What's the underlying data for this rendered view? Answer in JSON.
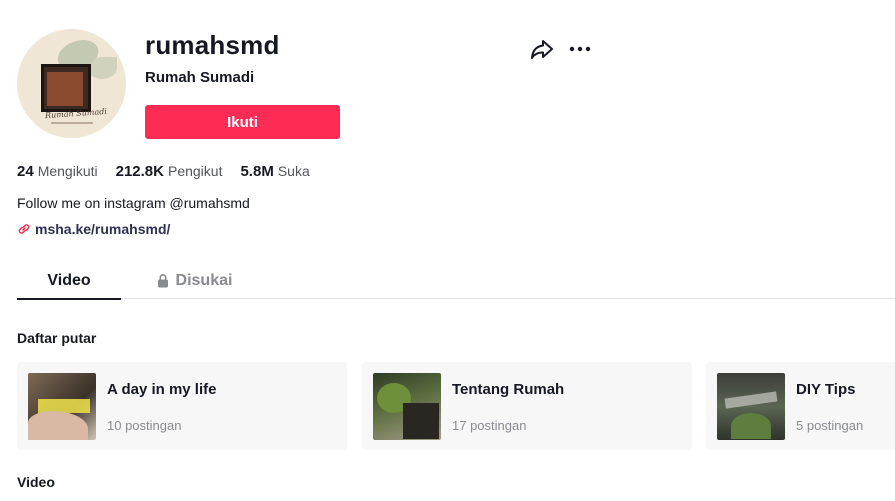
{
  "profile": {
    "username": "rumahsmd",
    "nickname": "Rumah Sumadi",
    "avatar_icon": "rumah-sumadi-logo",
    "avatar_caption": "Rumah Sumadi",
    "follow_label": "Ikuti",
    "bio": "Follow me on instagram @rumahsmd",
    "link": "msha.ke/rumahsmd/"
  },
  "stats": [
    {
      "value": "24",
      "label": "Mengikuti"
    },
    {
      "value": "212.8K",
      "label": "Pengikut"
    },
    {
      "value": "5.8M",
      "label": "Suka"
    }
  ],
  "actions": {
    "share_icon": "share-arrow",
    "more_icon": "ellipsis"
  },
  "tabs": [
    {
      "label": "Video",
      "active": true
    },
    {
      "label": "Disukai",
      "icon": "lock",
      "active": false
    }
  ],
  "playlists_section": {
    "title": "Daftar putar",
    "items": [
      {
        "name": "A day in my life",
        "count": "10 postingan"
      },
      {
        "name": "Tentang Rumah",
        "count": "17 postingan"
      },
      {
        "name": "DIY Tips",
        "count": "5 postingan"
      }
    ]
  },
  "videos_section": {
    "title": "Video"
  },
  "colors": {
    "accent": "#fe2c55",
    "text": "#161823",
    "muted": "#8a8b91",
    "card_bg": "#f7f7f7"
  }
}
